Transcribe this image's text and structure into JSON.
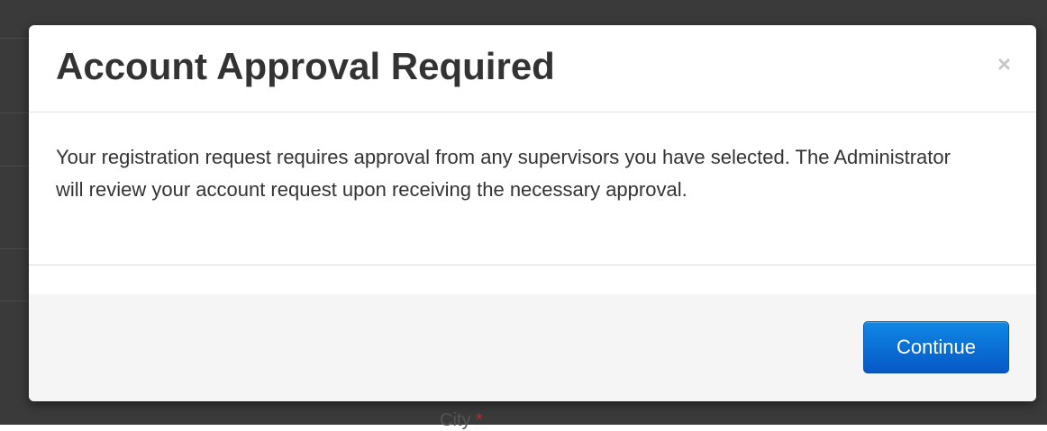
{
  "modal": {
    "title": "Account Approval Required",
    "close_glyph": "×",
    "close_icon": "close-icon",
    "body_text": "Your registration request requires approval from any supervisors you have selected. The Administrator will review your account request upon receiving the necessary approval.",
    "continue_label": "Continue"
  },
  "background": {
    "field_label": "City",
    "required_marker": "*"
  },
  "colors": {
    "primary_button": "#0a6fd6",
    "backdrop": "#3a3a3a",
    "title_text": "#333333"
  }
}
